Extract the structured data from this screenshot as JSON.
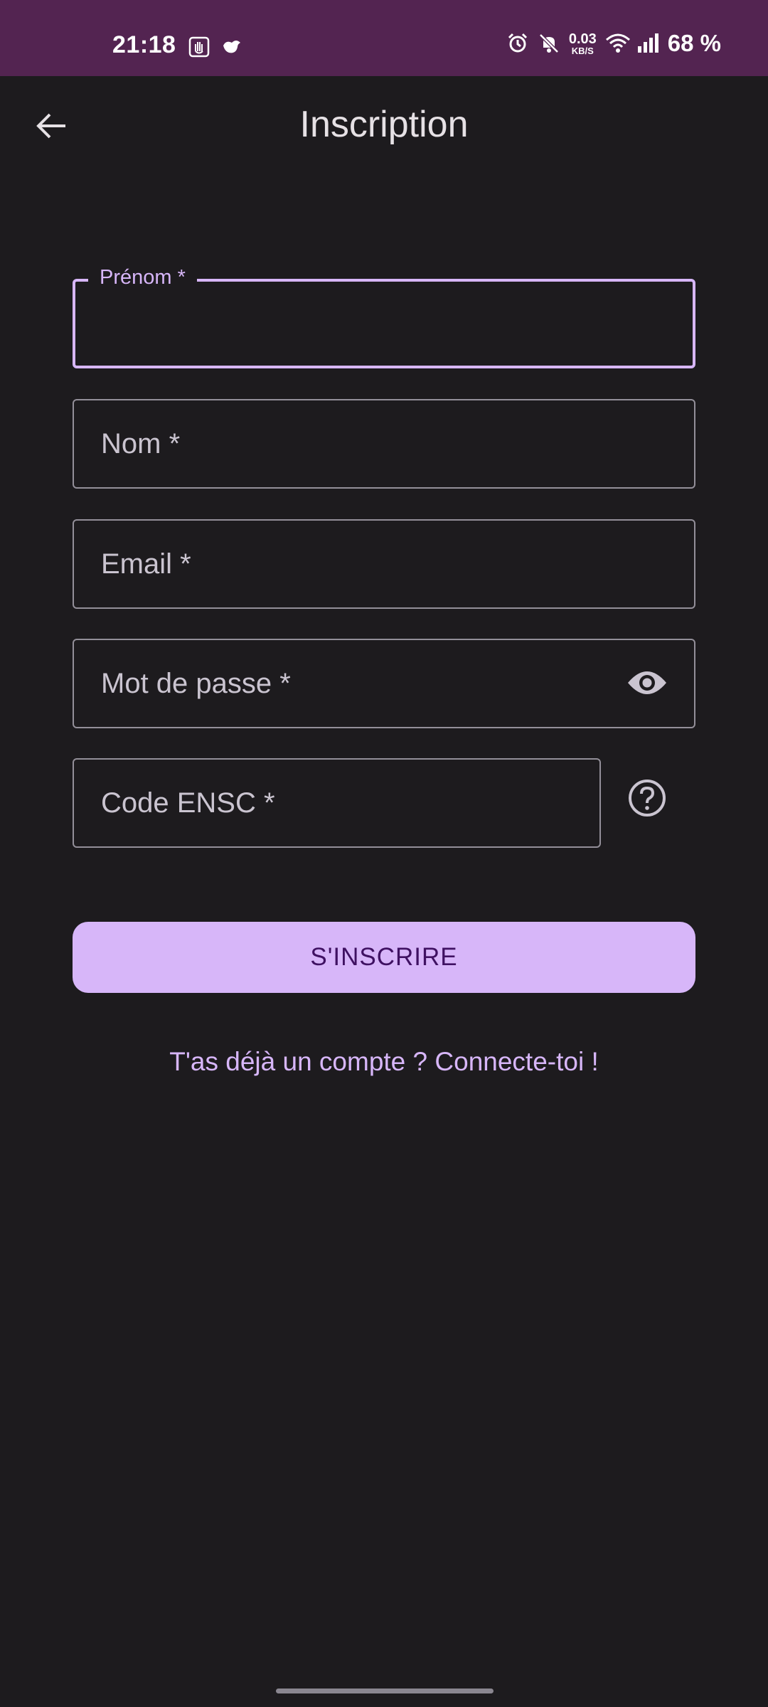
{
  "status_bar": {
    "time": "21:18",
    "net_speed_value": "0.03",
    "net_speed_unit": "KB/S",
    "battery": "68 %",
    "icons": [
      "hand-icon",
      "bird-icon",
      "alarm-icon",
      "mute-icon",
      "wifi-icon",
      "signal-icon"
    ]
  },
  "header": {
    "title": "Inscription",
    "back_icon": "arrow-left-icon"
  },
  "form": {
    "first_name": {
      "label": "Prénom *",
      "value": ""
    },
    "last_name": {
      "placeholder": "Nom *",
      "value": ""
    },
    "email": {
      "placeholder": "Email *",
      "value": ""
    },
    "password": {
      "placeholder": "Mot de passe *",
      "value": "",
      "toggle_icon": "eye-icon"
    },
    "code": {
      "placeholder": "Code ENSC *",
      "value": "",
      "help_icon": "help-circle-icon"
    },
    "submit_label": "S'INSCRIRE",
    "login_link": "T'as déjà un compte ? Connecte-toi !"
  },
  "colors": {
    "status_bar_bg": "#532451",
    "background": "#1d1b1e",
    "accent": "#d7b6f9",
    "button_text": "#3f1162",
    "outline": "#938f99"
  }
}
